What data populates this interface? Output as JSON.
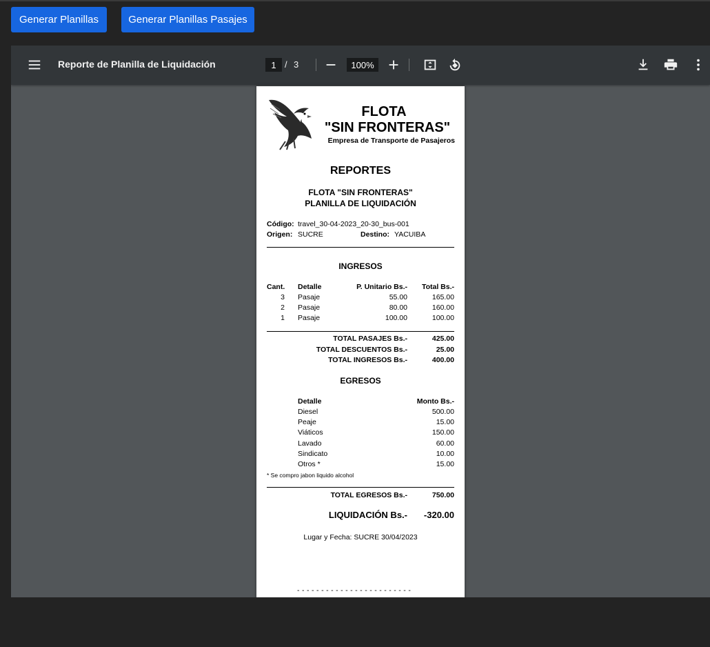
{
  "buttons": {
    "generar_planillas": "Generar Planillas",
    "generar_planillas_pasajes": "Generar Planillas Pasajes"
  },
  "viewer": {
    "title": "Reporte de Planilla de Liquidación",
    "current_page": "1",
    "page_separator": "/",
    "total_pages": "3",
    "zoom": "100%",
    "icons": [
      "menu-icon",
      "zoom-out-icon",
      "zoom-in-icon",
      "fit-page-icon",
      "rotate-icon",
      "download-icon",
      "print-icon",
      "more-vert-icon"
    ]
  },
  "report": {
    "header": {
      "flota": "FLOTA",
      "nombre": "\"SIN FRONTERAS\"",
      "empresa": "Empresa de Transporte de Pasajeros"
    },
    "reportes": "REPORTES",
    "subtitle1": "FLOTA \"SIN FRONTERAS\"",
    "subtitle2": "PLANILLA DE LIQUIDACIÓN",
    "codigo_label": "Código:",
    "codigo": "travel_30-04-2023_20-30_bus-001",
    "origen_label": "Origen:",
    "origen": "SUCRE",
    "destino_label": "Destino:",
    "destino": "YACUIBA",
    "ingresos": {
      "title": "INGRESOS",
      "headers": {
        "cant": "Cant.",
        "detalle": "Detalle",
        "unitario": "P. Unitario Bs.-",
        "total": "Total Bs.-"
      },
      "rows": [
        {
          "cant": "3",
          "detalle": "Pasaje",
          "unitario": "55.00",
          "total": "165.00"
        },
        {
          "cant": "2",
          "detalle": "Pasaje",
          "unitario": "80.00",
          "total": "160.00"
        },
        {
          "cant": "1",
          "detalle": "Pasaje",
          "unitario": "100.00",
          "total": "100.00"
        }
      ],
      "total_pasajes_label": "TOTAL PASAJES Bs.-",
      "total_pasajes": "425.00",
      "total_descuentos_label": "TOTAL DESCUENTOS Bs.-",
      "total_descuentos": "25.00",
      "total_ingresos_label": "TOTAL INGRESOS Bs.-",
      "total_ingresos": "400.00"
    },
    "egresos": {
      "title": "EGRESOS",
      "headers": {
        "detalle": "Detalle",
        "monto": "Monto Bs.-"
      },
      "rows": [
        {
          "detalle": "Diesel",
          "monto": "500.00"
        },
        {
          "detalle": "Peaje",
          "monto": "15.00"
        },
        {
          "detalle": "Viáticos",
          "monto": "150.00"
        },
        {
          "detalle": "Lavado",
          "monto": "60.00"
        },
        {
          "detalle": "Sindicato",
          "monto": "10.00"
        },
        {
          "detalle": "Otros *",
          "monto": "15.00"
        }
      ],
      "nota": "* Se compro jabon liquido alcohol",
      "total_label": "TOTAL EGRESOS Bs.-",
      "total": "750.00"
    },
    "liquidacion_label": "LIQUIDACIÓN Bs.-",
    "liquidacion": "-320.00",
    "lugar_fecha": "Lugar y Fecha: SUCRE 30/04/2023",
    "firma_linea": "- - - - - - - - - - - - - - - - - - - - - - - -"
  }
}
